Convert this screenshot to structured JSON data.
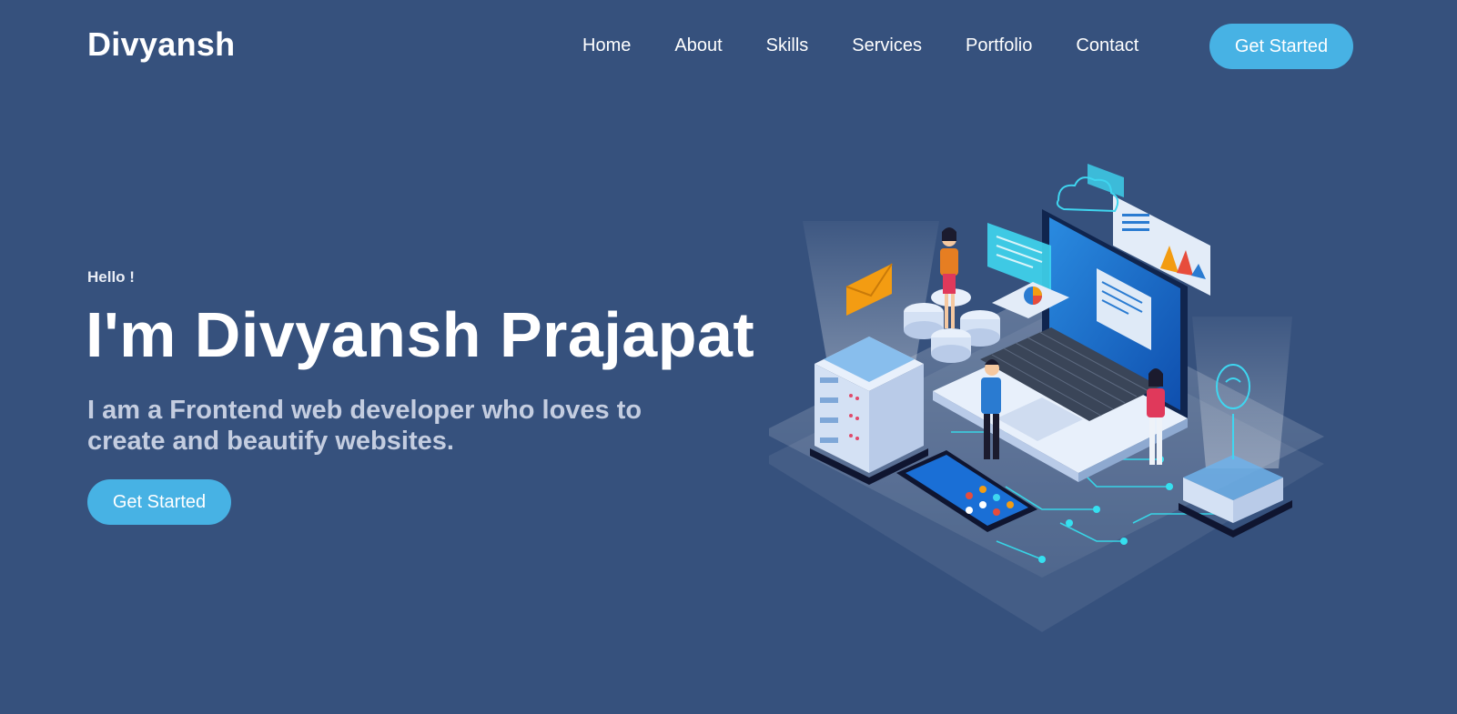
{
  "header": {
    "logo": "Divyansh",
    "nav": [
      "Home",
      "About",
      "Skills",
      "Services",
      "Portfolio",
      "Contact"
    ],
    "cta_label": "Get Started"
  },
  "hero": {
    "greeting": "Hello !",
    "title": "I'm Divyansh Prajapat",
    "subtitle": "I am a Frontend web developer who loves to create and beautify websites.",
    "cta_label": "Get Started"
  },
  "colors": {
    "background": "#36517d",
    "accent": "#47b2e4",
    "text": "#ffffff",
    "subtitle": "#c4cde0"
  },
  "illustration": {
    "icon": "isometric-web-development-illustration"
  }
}
